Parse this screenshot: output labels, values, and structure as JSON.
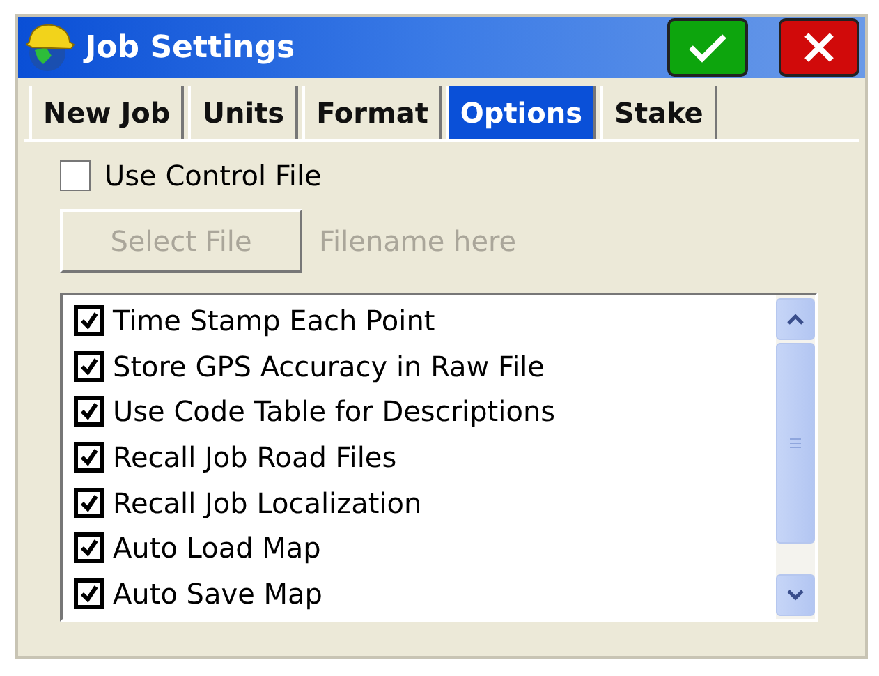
{
  "window": {
    "title": "Job Settings"
  },
  "title_buttons": [
    {
      "kind": "ok"
    },
    {
      "kind": "cancel"
    }
  ],
  "tabs": [
    {
      "label": "New Job",
      "selected": false
    },
    {
      "label": "Units",
      "selected": false
    },
    {
      "label": "Format",
      "selected": false
    },
    {
      "label": "Options",
      "selected": true
    },
    {
      "label": "Stake",
      "selected": false
    }
  ],
  "use_control_file": {
    "label": "Use Control File",
    "checked": false
  },
  "select_file_button": {
    "label": "Select File",
    "disabled": true
  },
  "filename": {
    "text": "Filename here",
    "disabled": true
  },
  "options": [
    {
      "label": "Time Stamp Each Point",
      "checked": true
    },
    {
      "label": "Store GPS Accuracy in Raw File",
      "checked": true
    },
    {
      "label": "Use Code Table for Descriptions",
      "checked": true
    },
    {
      "label": "Recall Job Road Files",
      "checked": true
    },
    {
      "label": "Recall Job Localization",
      "checked": true
    },
    {
      "label": "Auto Load Map",
      "checked": true
    },
    {
      "label": "Auto Save Map",
      "checked": true
    }
  ]
}
